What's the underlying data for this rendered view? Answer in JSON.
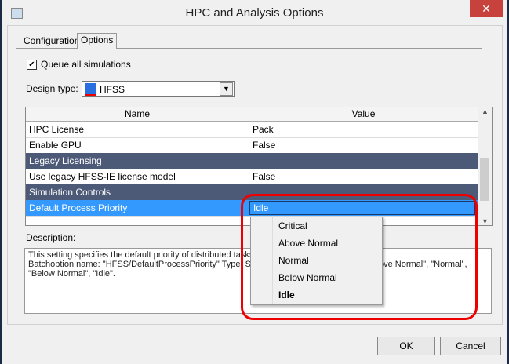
{
  "window": {
    "title": "HPC and Analysis Options",
    "close": "✕"
  },
  "tabs": [
    "Configurations",
    "Options"
  ],
  "queue_all": {
    "label": "Queue all simulations",
    "checked": true
  },
  "design_type": {
    "label": "Design type:",
    "value": "HFSS"
  },
  "table": {
    "headers": [
      "Name",
      "Value"
    ],
    "rows": [
      {
        "name": "HPC License",
        "value": "Pack",
        "kind": "row"
      },
      {
        "name": "Enable GPU",
        "value": "False",
        "kind": "row"
      },
      {
        "name": "Legacy Licensing",
        "value": "",
        "kind": "cat"
      },
      {
        "name": "Use legacy HFSS-IE license model",
        "value": "False",
        "kind": "row"
      },
      {
        "name": "Simulation Controls",
        "value": "",
        "kind": "cat"
      },
      {
        "name": "Default Process Priority",
        "value": "Idle",
        "kind": "sel"
      }
    ]
  },
  "description": {
    "label": "Description:",
    "line1": "This setting specifies the default priority of distributed tasks.",
    "line2a": "Batchoption name: \"HFSS/DefaultProcessPriority\" Type: Str",
    "line2b": "ove Normal\", \"Normal\",",
    "line3": "\"Below Normal\", \"Idle\"."
  },
  "dropdown": {
    "options": [
      "Critical",
      "Above Normal",
      "Normal",
      "Below Normal",
      "Idle"
    ],
    "selected": "Idle"
  },
  "buttons": {
    "ok": "OK",
    "cancel": "Cancel"
  }
}
